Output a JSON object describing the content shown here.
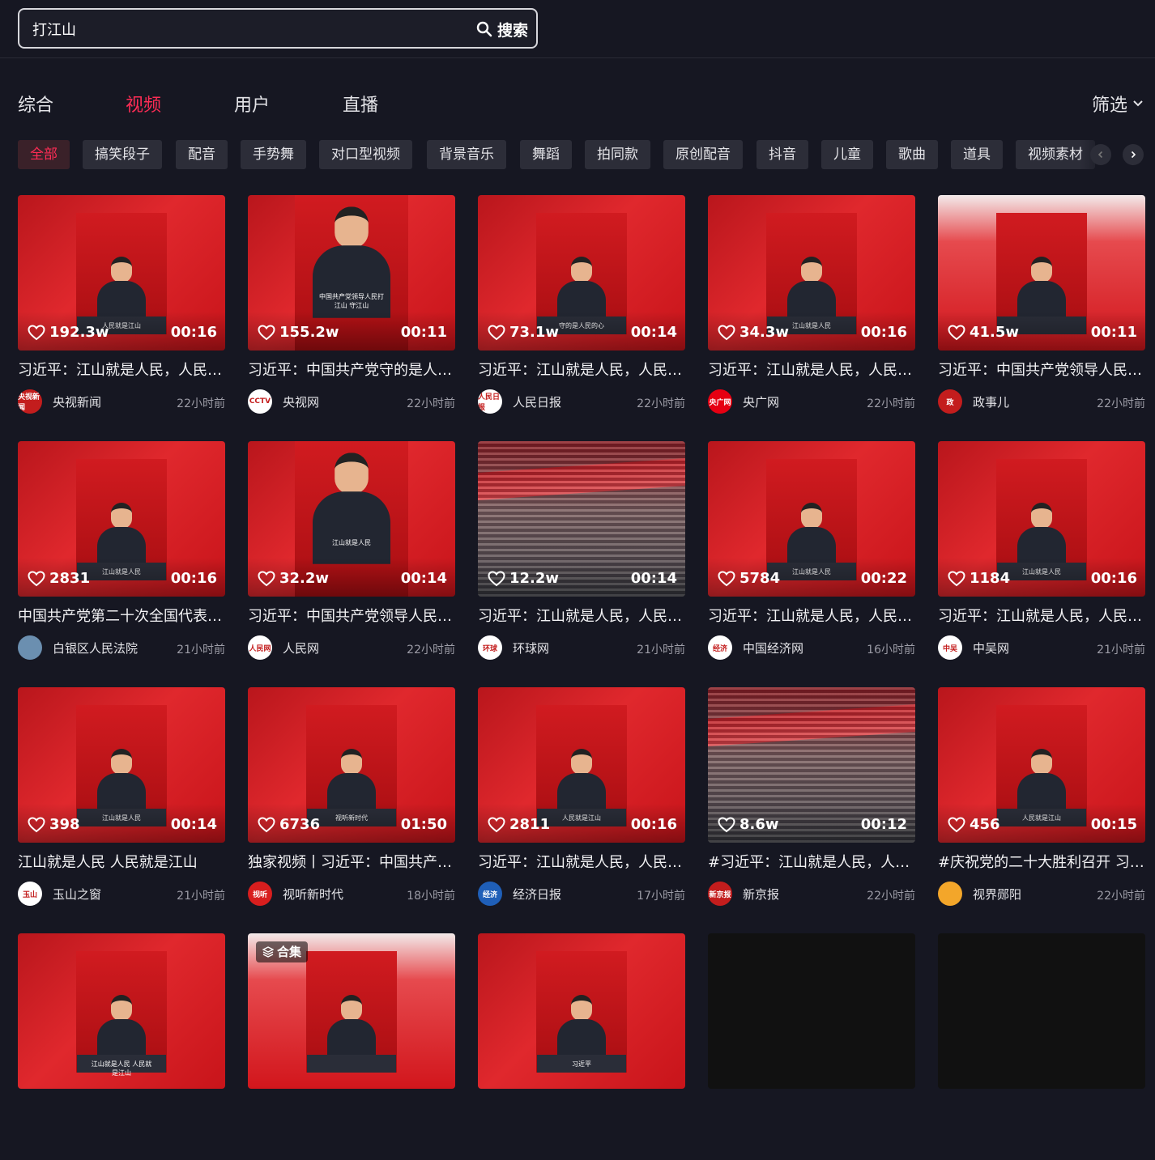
{
  "search": {
    "query": "打江山",
    "button_label": "搜索"
  },
  "tabs": [
    {
      "label": "综合"
    },
    {
      "label": "视频"
    },
    {
      "label": "用户"
    },
    {
      "label": "直播"
    }
  ],
  "filter_label": "筛选",
  "chips": [
    "全部",
    "搞笑段子",
    "配音",
    "手势舞",
    "对口型视频",
    "背景音乐",
    "舞蹈",
    "拍同款",
    "原创配音",
    "抖音",
    "儿童",
    "歌曲",
    "道具",
    "视频素材"
  ],
  "videos": [
    {
      "likes": "192.3w",
      "duration": "00:16",
      "title": "习近平：江山就是人民，人民…",
      "author": "央视新闻",
      "time": "22小时前",
      "avatar_text": "央视新闻",
      "avatar_color": "#c31d1d",
      "style": "red",
      "caption": "人民就是江山"
    },
    {
      "likes": "155.2w",
      "duration": "00:11",
      "title": "习近平：中国共产党守的是人…",
      "author": "央视网",
      "time": "22小时前",
      "avatar_text": "CCTV",
      "avatar_color": "#ffffff",
      "style": "closeup",
      "caption": "中国共产党领导人民打江山 守江山"
    },
    {
      "likes": "73.1w",
      "duration": "00:14",
      "title": "习近平：江山就是人民，人民…",
      "author": "人民日报",
      "time": "22小时前",
      "avatar_text": "人民日报",
      "avatar_color": "#ffffff",
      "style": "red",
      "caption": "守的是人民的心"
    },
    {
      "likes": "34.3w",
      "duration": "00:16",
      "title": "习近平：江山就是人民，人民…",
      "author": "央广网",
      "time": "22小时前",
      "avatar_text": "央广网",
      "avatar_color": "#e60012",
      "style": "red",
      "caption": "江山就是人民"
    },
    {
      "likes": "41.5w",
      "duration": "00:11",
      "title": "习近平：中国共产党领导人民…",
      "author": "政事儿",
      "time": "22小时前",
      "avatar_text": "政",
      "avatar_color": "#c31d1d",
      "style": "pale",
      "caption": ""
    },
    {
      "likes": "2831",
      "duration": "00:16",
      "title": "中国共产党第二十次全国代表…",
      "author": "白银区人民法院",
      "time": "21小时前",
      "avatar_text": "",
      "avatar_color": "#6b8fb0",
      "style": "red",
      "caption": "江山就是人民"
    },
    {
      "likes": "32.2w",
      "duration": "00:14",
      "title": "习近平：中国共产党领导人民…",
      "author": "人民网",
      "time": "22小时前",
      "avatar_text": "人民网",
      "avatar_color": "#ffffff",
      "style": "closeup",
      "caption": "江山就是人民"
    },
    {
      "likes": "12.2w",
      "duration": "00:14",
      "title": "习近平：江山就是人民，人民…",
      "author": "环球网",
      "time": "21小时前",
      "avatar_text": "环球",
      "avatar_color": "#ffffff",
      "style": "hall",
      "caption": ""
    },
    {
      "likes": "5784",
      "duration": "00:22",
      "title": "习近平：江山就是人民，人民…",
      "author": "中国经济网",
      "time": "16小时前",
      "avatar_text": "经济",
      "avatar_color": "#ffffff",
      "style": "red",
      "caption": "江山就是人民"
    },
    {
      "likes": "1184",
      "duration": "00:16",
      "title": "习近平：江山就是人民，人民…",
      "author": "中吴网",
      "time": "21小时前",
      "avatar_text": "中吴",
      "avatar_color": "#ffffff",
      "style": "red",
      "caption": "江山就是人民"
    },
    {
      "likes": "398",
      "duration": "00:14",
      "title": "江山就是人民 人民就是江山",
      "author": "玉山之窗",
      "time": "21小时前",
      "avatar_text": "玉山",
      "avatar_color": "#ffffff",
      "style": "red",
      "caption": "江山就是人民"
    },
    {
      "likes": "6736",
      "duration": "01:50",
      "title": "独家视频丨习近平：中国共产…",
      "author": "视听新时代",
      "time": "18小时前",
      "avatar_text": "视听",
      "avatar_color": "#d81e1e",
      "style": "red",
      "caption": "视听新时代"
    },
    {
      "likes": "2811",
      "duration": "00:16",
      "title": "习近平：江山就是人民，人民…",
      "author": "经济日报",
      "time": "17小时前",
      "avatar_text": "经济",
      "avatar_color": "#1f5fb8",
      "style": "red",
      "caption": "人民就是江山"
    },
    {
      "likes": "8.6w",
      "duration": "00:12",
      "title": "#习近平：江山就是人民，人民…",
      "author": "新京报",
      "time": "22小时前",
      "avatar_text": "新京报",
      "avatar_color": "#c31d1d",
      "style": "hall",
      "caption": ""
    },
    {
      "likes": "456",
      "duration": "00:15",
      "title": "#庆祝党的二十大胜利召开 习…",
      "author": "视界郧阳",
      "time": "22小时前",
      "avatar_text": "",
      "avatar_color": "#f3a62a",
      "style": "red",
      "caption": "人民就是江山"
    },
    {
      "likes": "",
      "duration": "",
      "title": "",
      "author": "",
      "time": "",
      "avatar_text": "",
      "avatar_color": "#c31d1d",
      "style": "red",
      "caption": "江山就是人民 人民就是江山"
    },
    {
      "likes": "",
      "duration": "",
      "title": "",
      "author": "",
      "time": "",
      "avatar_text": "",
      "avatar_color": "#c31d1d",
      "style": "pale",
      "caption": "",
      "badge": "合集"
    },
    {
      "likes": "",
      "duration": "",
      "title": "",
      "author": "",
      "time": "",
      "avatar_text": "",
      "avatar_color": "#c31d1d",
      "style": "red",
      "caption": "习近平"
    },
    {
      "likes": "",
      "duration": "",
      "title": "",
      "author": "",
      "time": "",
      "avatar_text": "",
      "avatar_color": "#333",
      "style": "dark",
      "caption": ""
    },
    {
      "likes": "",
      "duration": "",
      "title": "",
      "author": "",
      "time": "",
      "avatar_text": "",
      "avatar_color": "#333",
      "style": "dark",
      "caption": ""
    }
  ]
}
